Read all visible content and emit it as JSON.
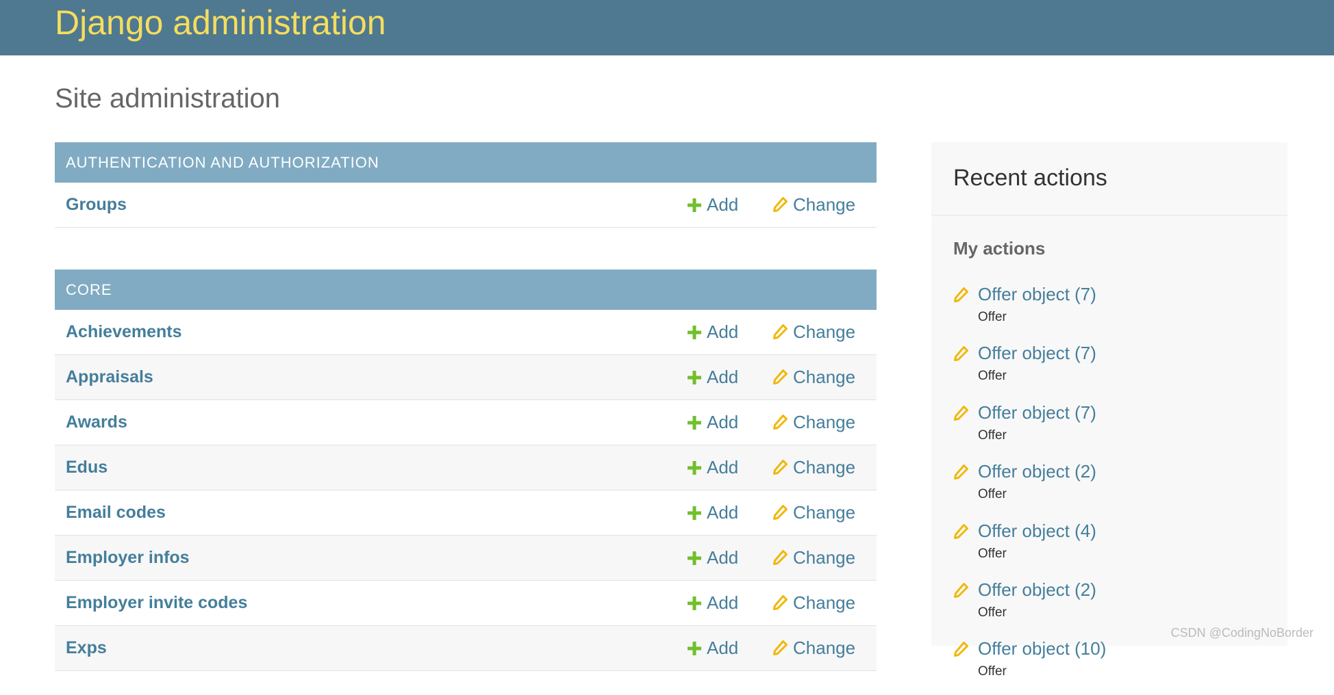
{
  "header": {
    "branding": "Django administration"
  },
  "page": {
    "title": "Site administration"
  },
  "modules": [
    {
      "caption": "AUTHENTICATION AND AUTHORIZATION",
      "rows": [
        {
          "name": "Groups",
          "add_label": "Add",
          "change_label": "Change"
        }
      ]
    },
    {
      "caption": "CORE",
      "rows": [
        {
          "name": "Achievements",
          "add_label": "Add",
          "change_label": "Change"
        },
        {
          "name": "Appraisals",
          "add_label": "Add",
          "change_label": "Change"
        },
        {
          "name": "Awards",
          "add_label": "Add",
          "change_label": "Change"
        },
        {
          "name": "Edus",
          "add_label": "Add",
          "change_label": "Change"
        },
        {
          "name": "Email codes",
          "add_label": "Add",
          "change_label": "Change"
        },
        {
          "name": "Employer infos",
          "add_label": "Add",
          "change_label": "Change"
        },
        {
          "name": "Employer invite codes",
          "add_label": "Add",
          "change_label": "Change"
        },
        {
          "name": "Exps",
          "add_label": "Add",
          "change_label": "Change"
        }
      ]
    }
  ],
  "sidebar": {
    "title": "Recent actions",
    "my_actions_title": "My actions",
    "actions": [
      {
        "link": "Offer object (7)",
        "type": "Offer"
      },
      {
        "link": "Offer object (7)",
        "type": "Offer"
      },
      {
        "link": "Offer object (7)",
        "type": "Offer"
      },
      {
        "link": "Offer object (2)",
        "type": "Offer"
      },
      {
        "link": "Offer object (4)",
        "type": "Offer"
      },
      {
        "link": "Offer object (2)",
        "type": "Offer"
      },
      {
        "link": "Offer object (10)",
        "type": "Offer"
      }
    ]
  },
  "icons": {
    "add": "plus-icon",
    "change": "pencil-icon"
  },
  "colors": {
    "header_bg": "#4f7891",
    "branding_text": "#f5dd5d",
    "caption_bg": "#81abc3",
    "link": "#447e9b",
    "add_icon": "#70bf2b",
    "change_icon": "#efb80b"
  },
  "watermark": "CSDN @CodingNoBorder"
}
